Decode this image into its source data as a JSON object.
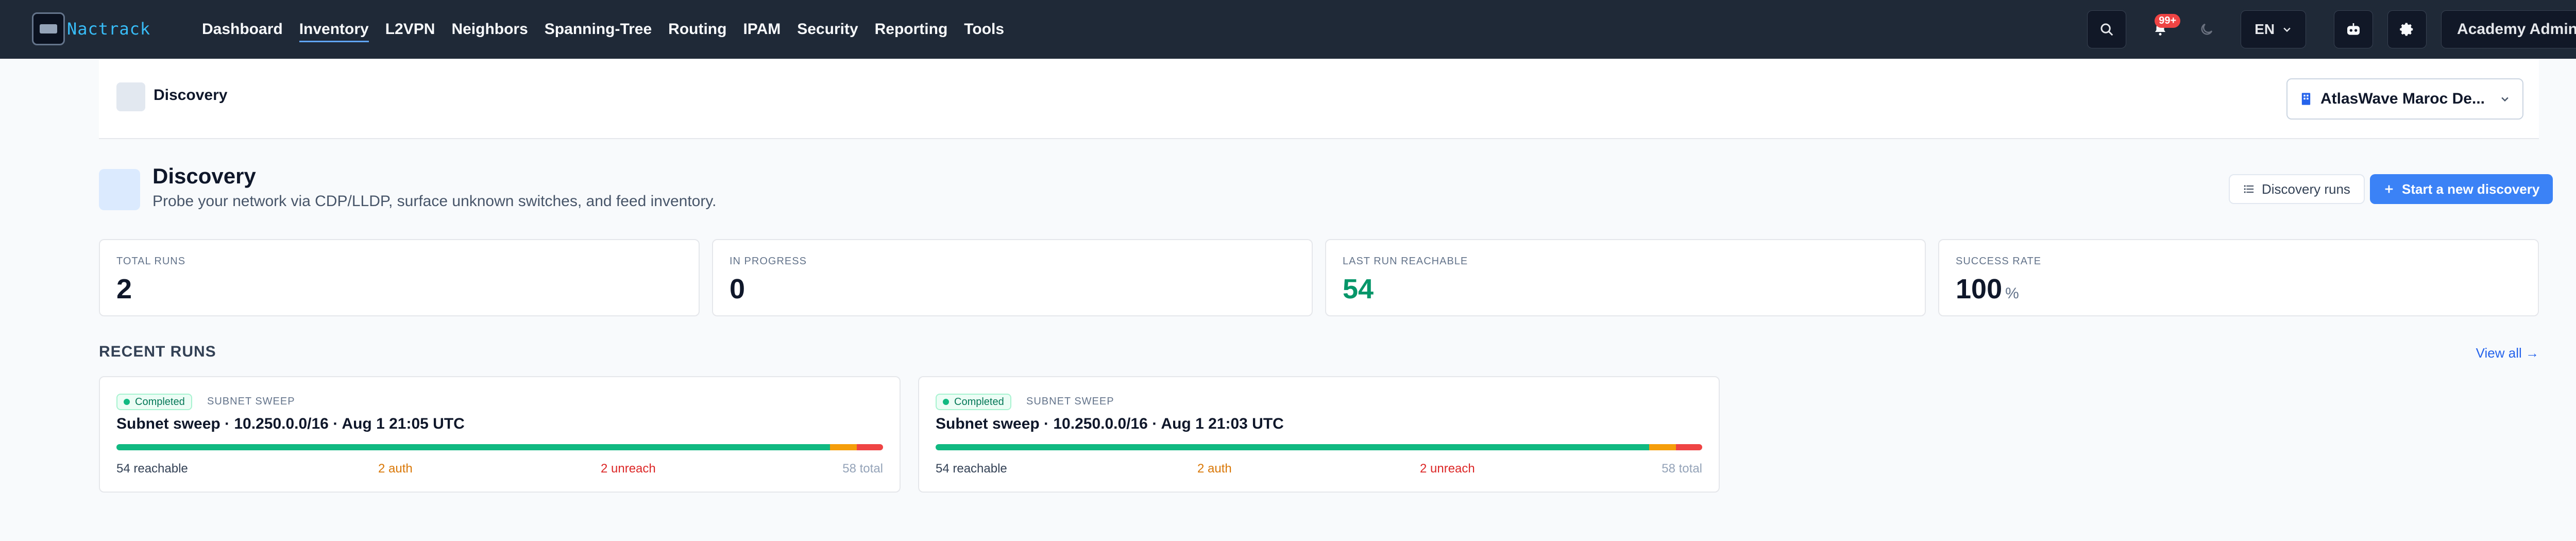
{
  "navbar": {
    "brand": "Nactrack",
    "links": [
      "Dashboard",
      "Inventory",
      "L2VPN",
      "Neighbors",
      "Spanning-Tree",
      "Routing",
      "IPAM",
      "Security",
      "Reporting",
      "Tools"
    ],
    "active_link": "Inventory",
    "notification_badge": "99+",
    "language": "EN",
    "user": "Academy Admin"
  },
  "subheader": {
    "title": "Discovery",
    "site": "AtlasWave Maroc De..."
  },
  "page": {
    "title": "Discovery",
    "subtitle": "Probe your network via CDP/LLDP, surface unknown switches, and feed inventory.",
    "runs_button": "Discovery runs",
    "start_button": "Start a new discovery"
  },
  "stats": [
    {
      "label": "TOTAL RUNS",
      "value": "2",
      "unit": ""
    },
    {
      "label": "IN PROGRESS",
      "value": "0",
      "unit": ""
    },
    {
      "label": "LAST RUN REACHABLE",
      "value": "54",
      "unit": ""
    },
    {
      "label": "SUCCESS RATE",
      "value": "100",
      "unit": "%"
    }
  ],
  "recent": {
    "title": "RECENT RUNS",
    "view_all": "View all →",
    "runs": [
      {
        "status": "Completed",
        "type": "SUBNET SWEEP",
        "title": "Subnet sweep · 10.250.0.0/16 · Aug 1 21:05 UTC",
        "reachable": 54,
        "auth": 2,
        "unreach": 2,
        "total": 58,
        "reachable_label": "54 reachable",
        "auth_label": "2 auth",
        "unreach_label": "2 unreach",
        "total_label": "58 total"
      },
      {
        "status": "Completed",
        "type": "SUBNET SWEEP",
        "title": "Subnet sweep · 10.250.0.0/16 · Aug 1 21:03 UTC",
        "reachable": 54,
        "auth": 2,
        "unreach": 2,
        "total": 58,
        "reachable_label": "54 reachable",
        "auth_label": "2 auth",
        "unreach_label": "2 unreach",
        "total_label": "58 total"
      }
    ]
  },
  "icons": {
    "search": "search-icon",
    "bell": "bell-icon",
    "moon": "moon-icon",
    "robot": "robot-icon",
    "gear": "gear-icon",
    "building": "building-icon",
    "list": "list-icon",
    "plus": "plus-icon"
  },
  "colors": {
    "navbar": "#1f2937",
    "accent": "#3b82f6",
    "reachable": "#10b981",
    "auth": "#f59e0b",
    "unreach": "#ef4444"
  }
}
